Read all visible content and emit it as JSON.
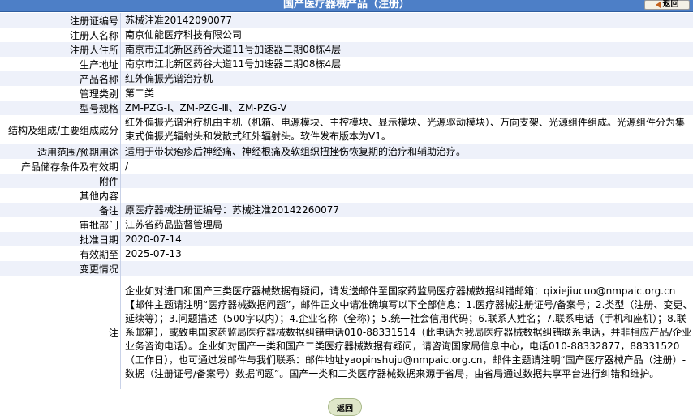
{
  "header": {
    "title": "国产医疗器械产品（注册）",
    "back_label": "返回"
  },
  "fields": [
    {
      "label": "注册证编号",
      "value": "苏械注准20142090077"
    },
    {
      "label": "注册人名称",
      "value": "南京仙能医疗科技有限公司"
    },
    {
      "label": "注册人住所",
      "value": "南京市江北新区药谷大道11号加速器二期08栋4层"
    },
    {
      "label": "生产地址",
      "value": "南京市江北新区药谷大道11号加速器二期08栋4层"
    },
    {
      "label": "产品名称",
      "value": "红外偏振光谱治疗机"
    },
    {
      "label": "管理类别",
      "value": "第二类"
    },
    {
      "label": "型号规格",
      "value": "ZM-PZG-Ⅰ、ZM-PZG-Ⅲ、ZM-PZG-V"
    },
    {
      "label": "结构及组成/主要组成成分",
      "value": "红外偏振光谱治疗机由主机（机箱、电源模块、主控模块、显示模块、光源驱动模块）、万向支架、光源组件组成。光源组件分为集束式偏振光辐射头和发散式红外辐射头。软件发布版本为V1。"
    },
    {
      "label": "适用范围/预期用途",
      "value": "适用于带状疱疹后神经痛、神经根痛及软组织扭挫伤恢复期的治疗和辅助治疗。"
    },
    {
      "label": "产品储存条件及有效期",
      "value": "/"
    },
    {
      "label": "附件",
      "value": ""
    },
    {
      "label": "其他内容",
      "value": ""
    },
    {
      "label": "备注",
      "value": "原医疗器械注册证编号：苏械注准20142260077"
    },
    {
      "label": "审批部门",
      "value": "江苏省药品监督管理局"
    },
    {
      "label": "批准日期",
      "value": "2020-07-14"
    },
    {
      "label": "有效期至",
      "value": "2025-07-13"
    },
    {
      "label": "变更情况",
      "value": ""
    }
  ],
  "note": {
    "label": "注",
    "text": "企业如对进口和国产三类医疗器械数据有疑问，请发送邮件至国家药监局医疗器械数据纠错邮箱：qixiejiucuo@nmpaic.org.cn【邮件主题请注明“医疗器械数据问题”，邮件正文中请准确填写以下全部信息：1.医疗器械注册证号/备案号；2.类型（注册、变更、延续等）；3.问题描述（500字以内）；4.企业名称（全称）；5.统一社会信用代码；6.联系人姓名；7.联系电话（手机和座机）；8.联系邮箱】，或致电国家药监局医疗器械数据纠错电话010-88331514（此电话为我局医疗器械数据纠错联系电话，并非相应产品/企业业务咨询电话）。企业如对国产一类和国产二类医疗器械数据有疑问，请咨询国家局信息中心，电话010-88332877，88331520（工作日），也可通过发邮件与我们联系：邮件地址yaopinshuju@nmpaic.org.cn，邮件主题请注明“国产医疗器械产品（注册）-数据（注册证号/备案号）数据问题”。国产一类和二类医疗器械数据来源于省局，由省局通过数据共享平台进行纠错和维护。"
  },
  "footer": {
    "back_label": "返回"
  },
  "colors": {
    "titlebar": "#4d7fc7",
    "row_stripe": "#eef1fa",
    "row_plain": "#ffffff"
  }
}
